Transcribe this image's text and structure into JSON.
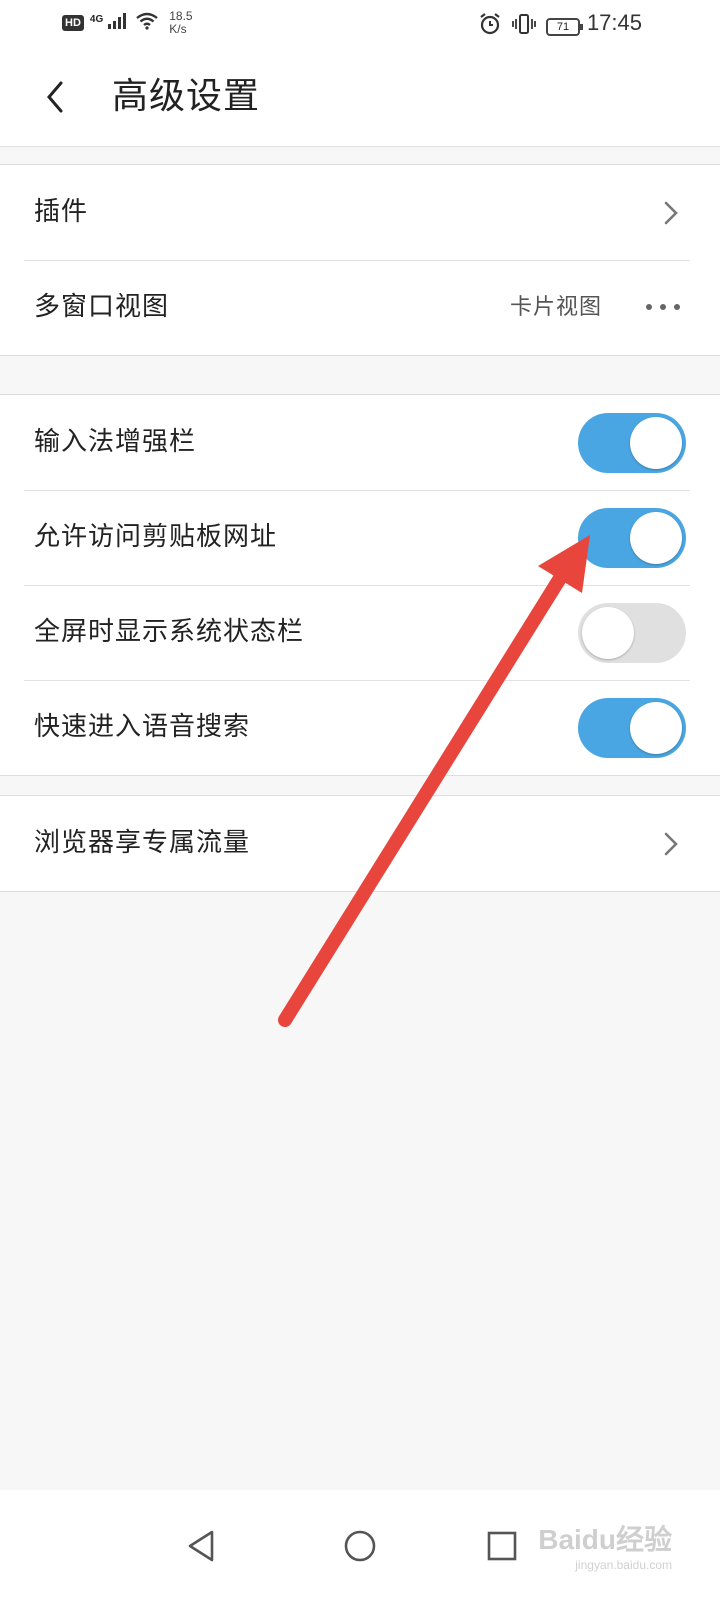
{
  "status_bar": {
    "hd": "HD",
    "network": "4G",
    "speed_value": "18.5",
    "speed_unit": "K/s",
    "battery": "71",
    "time": "17:45"
  },
  "header": {
    "title": "高级设置"
  },
  "group1": [
    {
      "label": "插件",
      "type": "chevron"
    },
    {
      "label": "多窗口视图",
      "value": "卡片视图",
      "type": "more"
    }
  ],
  "group2": [
    {
      "label": "输入法增强栏",
      "toggle": true
    },
    {
      "label": "允许访问剪贴板网址",
      "toggle": true
    },
    {
      "label": "全屏时显示系统状态栏",
      "toggle": false
    },
    {
      "label": "快速进入语音搜索",
      "toggle": true
    }
  ],
  "group3": [
    {
      "label": "浏览器享专属流量",
      "type": "chevron"
    }
  ],
  "watermark": {
    "main": "Baidu经验",
    "sub": "jingyan.baidu.com"
  },
  "colors": {
    "toggle_on": "#4aa6e2",
    "toggle_off": "#e0e0e0",
    "annotation_arrow": "#e8453c"
  },
  "icons": {
    "back": "chevron-left-icon",
    "row_chevron": "chevron-right-icon",
    "more": "more-dots-icon",
    "nav_back": "triangle-back-icon",
    "nav_home": "circle-home-icon",
    "nav_recent": "square-recents-icon",
    "alarm": "alarm-icon",
    "vibrate": "vibrate-icon",
    "wifi": "wifi-icon",
    "signal": "signal-icon"
  }
}
